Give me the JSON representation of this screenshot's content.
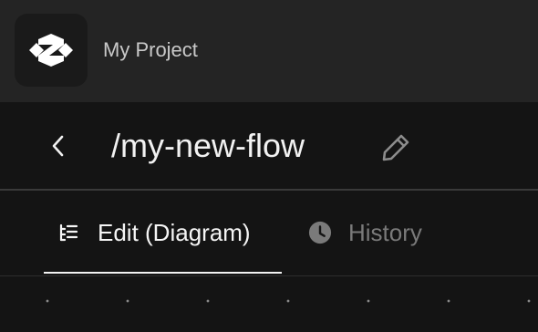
{
  "project": {
    "name": "My Project",
    "logo_icon": "project-logo-icon"
  },
  "flow": {
    "title": "/my-new-flow",
    "back_icon": "chevron-left-icon",
    "edit_icon": "pencil-icon"
  },
  "tabs": [
    {
      "label": "Edit (Diagram)",
      "icon": "diagram-list-icon",
      "active": true
    },
    {
      "label": "History",
      "icon": "clock-icon",
      "active": false
    }
  ],
  "colors": {
    "header_bg": "#242424",
    "page_bg": "#141414",
    "active_text": "#f5f5f5",
    "inactive_text": "#7a7a7a"
  }
}
